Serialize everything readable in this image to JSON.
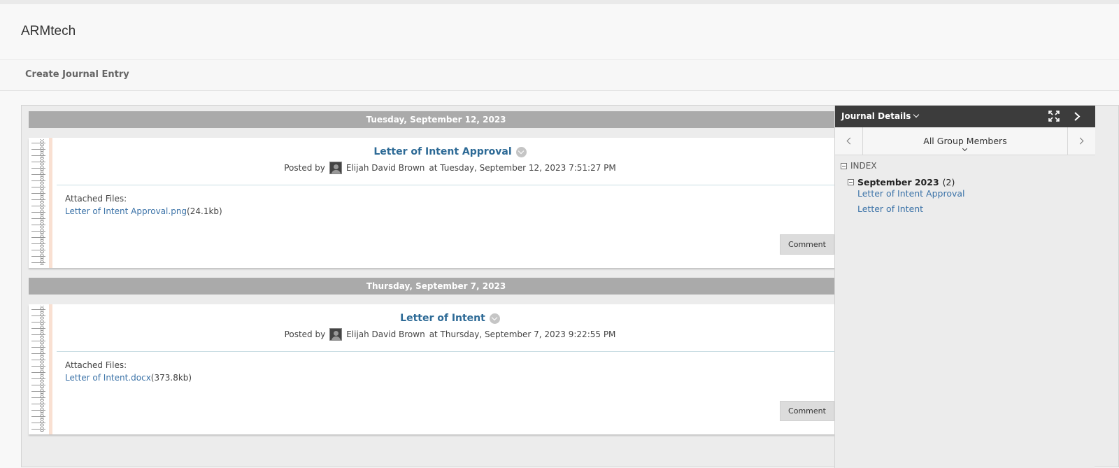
{
  "course": {
    "title": "ARMtech"
  },
  "actions": {
    "create_entry": "Create Journal Entry"
  },
  "entries": [
    {
      "date": "Tuesday, September 12, 2023",
      "title": "Letter of Intent Approval",
      "posted_by": "Posted by",
      "author": "Elijah David Brown",
      "posted_at": "at Tuesday, September 12, 2023 7:51:27 PM",
      "attached_label": "Attached Files:",
      "file_name": "Letter of Intent Approval.png",
      "file_size": "(24.1kb)",
      "comment_label": "Comment"
    },
    {
      "date": "Thursday, September 7, 2023",
      "title": "Letter of Intent",
      "posted_by": "Posted by",
      "author": "Elijah David Brown",
      "posted_at": "at Thursday, September 7, 2023 9:22:55 PM",
      "attached_label": "Attached Files:",
      "file_name": "Letter of Intent.docx",
      "file_size": "(373.8kb)",
      "comment_label": "Comment"
    }
  ],
  "sidebar": {
    "title": "Journal Details",
    "member_filter": "All Group Members",
    "index_label": "INDEX",
    "month": "September 2023",
    "month_count": "(2)",
    "links": [
      "Letter of Intent Approval",
      "Letter of Intent"
    ],
    "icons": [
      "expand-icon",
      "collapse-arrow-icon",
      "chevron-left-icon",
      "chevron-right-icon"
    ]
  },
  "colors": {
    "link": "#3c73a8",
    "title_link": "#2d6a96",
    "date_bar": "#aaaaaa",
    "sidebar_header": "#3c3c3c",
    "notebook_margin": "#f9e0d2"
  }
}
